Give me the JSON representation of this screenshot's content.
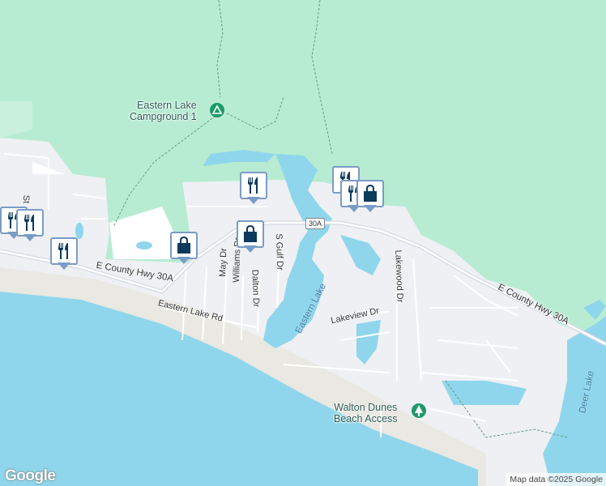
{
  "map": {
    "colors": {
      "forest": "#b8ecd2",
      "urban": "#eef0f4",
      "water": "#8fd6ec",
      "sand": "#e9e8e2",
      "road": "#ffffff",
      "highway": "#d4dae2"
    },
    "places": {
      "campground": "Eastern Lake\nCampground 1",
      "beach_access": "Walton Dunes\nBeach Access"
    },
    "water": {
      "eastern_lake": "Eastern Lake",
      "deer_lake": "Deer Lake"
    },
    "roads": {
      "hwy_west": "E County Hwy 30A",
      "hwy_east": "E County Hwy 30A",
      "shield": "30A",
      "eastern_lake_rd": "Eastern Lake Rd",
      "may_dr": "May Dr",
      "williams_dr": "Williams Dr",
      "dalton_dr": "Dalton Dr",
      "s_gulf_dr": "S Gulf Dr",
      "lakeview_dr": "Lakeview Dr",
      "lakewood_dr": "Lakewood Dr",
      "st_partial": "St"
    },
    "markers": [
      {
        "type": "restaurant",
        "icon": "fork-knife-icon"
      },
      {
        "type": "restaurant",
        "icon": "fork-knife-icon"
      },
      {
        "type": "restaurant",
        "icon": "fork-knife-icon"
      },
      {
        "type": "restaurant",
        "icon": "fork-knife-icon"
      },
      {
        "type": "shopping",
        "icon": "shopping-bag-icon"
      },
      {
        "type": "shopping",
        "icon": "shopping-bag-icon"
      },
      {
        "type": "restaurant",
        "icon": "fork-knife-icon"
      },
      {
        "type": "restaurant",
        "icon": "fork-knife-icon"
      },
      {
        "type": "shopping",
        "icon": "shopping-bag-icon"
      }
    ],
    "attribution": "Map data ©2025 Google",
    "logo": "Google"
  }
}
